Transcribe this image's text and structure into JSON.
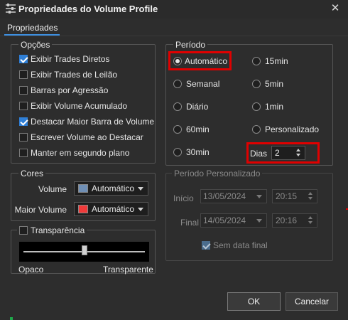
{
  "window": {
    "title": "Propriedades do Volume Profile",
    "close_glyph": "✕",
    "icon": "sliders-icon"
  },
  "tabs": [
    {
      "label": "Propriedades",
      "active": true
    }
  ],
  "opcoes": {
    "legend": "Opções",
    "items": [
      {
        "label": "Exibir Trades Diretos",
        "checked": true
      },
      {
        "label": "Exibir Trades de Leilão",
        "checked": false
      },
      {
        "label": "Barras por Agressão",
        "checked": false
      },
      {
        "label": "Exibir Volume Acumulado",
        "checked": false
      },
      {
        "label": "Destacar Maior Barra de Volume",
        "checked": true
      },
      {
        "label": "Escrever Volume ao Destacar",
        "checked": false
      },
      {
        "label": "Manter em segundo plano",
        "checked": false
      }
    ]
  },
  "cores": {
    "legend": "Cores",
    "volume": {
      "label": "Volume",
      "value": "Automático",
      "color": "#6f8fb5"
    },
    "maior_volume": {
      "label": "Maior Volume",
      "value": "Automático",
      "color": "#f03a3a"
    }
  },
  "transparencia": {
    "label": "Transparência",
    "checked": false,
    "min_label": "Opaco",
    "max_label": "Transparente",
    "level_fraction": 0.5
  },
  "periodo": {
    "legend": "Período",
    "selected": "Automático",
    "options_left": [
      "Automático",
      "Semanal",
      "Diário",
      "60min",
      "30min"
    ],
    "options_right": [
      "15min",
      "5min",
      "1min",
      "Personalizado"
    ],
    "dias": {
      "label": "Dias",
      "value": "2"
    }
  },
  "periodo_personalizado": {
    "legend": "Período Personalizado",
    "inicio": {
      "label": "Início",
      "date": "13/05/2024",
      "time": "20:15"
    },
    "final": {
      "label": "Final",
      "date": "14/05/2024",
      "time": "20:16"
    },
    "sem_data_final": {
      "label": "Sem data final",
      "checked": true
    }
  },
  "buttons": {
    "ok": "OK",
    "cancel": "Cancelar"
  },
  "colors": {
    "accent": "#2f7fd6",
    "highlight": "#e00000",
    "background": "#2d2d2d"
  }
}
